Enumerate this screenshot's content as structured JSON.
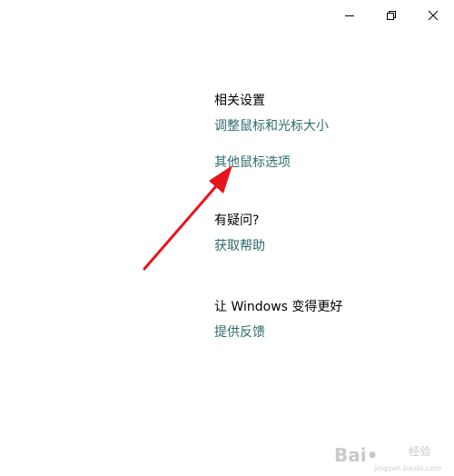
{
  "window": {
    "controls": {
      "minimize": "minimize-icon",
      "restore": "restore-icon",
      "close": "close-icon"
    }
  },
  "related_settings": {
    "heading": "相关设置",
    "links": [
      "调整鼠标和光标大小",
      "其他鼠标选项"
    ]
  },
  "help": {
    "heading": "有疑问?",
    "link": "获取帮助"
  },
  "feedback": {
    "heading": "让 Windows 变得更好",
    "link": "提供反馈"
  },
  "annotation": {
    "arrow_color": "#e8141b"
  },
  "watermark": {
    "brand": "Bai•",
    "sub": "经验",
    "url": "jingyan.baidu.com"
  },
  "colors": {
    "link": "#2e6b6b",
    "heading": "#000000",
    "background": "#ffffff"
  }
}
